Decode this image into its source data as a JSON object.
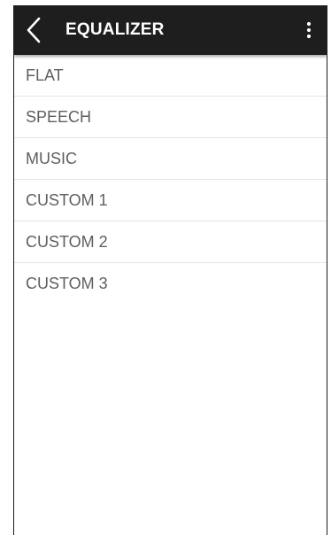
{
  "app_bar": {
    "title": "EQUALIZER",
    "back_icon": "chevron-left-icon",
    "menu_icon": "more-vertical-icon",
    "background": "#1e1e1e"
  },
  "presets": [
    {
      "label": "FLAT"
    },
    {
      "label": "SPEECH"
    },
    {
      "label": "MUSIC"
    },
    {
      "label": "CUSTOM 1"
    },
    {
      "label": "CUSTOM 2"
    },
    {
      "label": "CUSTOM 3"
    }
  ]
}
